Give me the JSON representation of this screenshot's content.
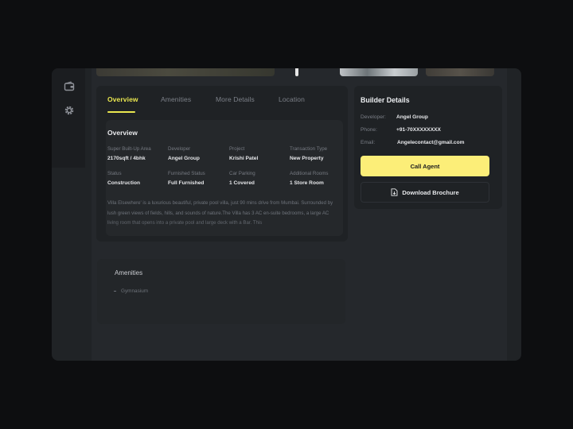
{
  "sidebar": {
    "icons": [
      "wallet-icon",
      "gear-icon"
    ]
  },
  "tabs": [
    {
      "label": "Overview",
      "active": true
    },
    {
      "label": "Amenities",
      "active": false
    },
    {
      "label": "More Details",
      "active": false
    },
    {
      "label": "Location",
      "active": false
    }
  ],
  "overview": {
    "title": "Overview",
    "fields": [
      {
        "label": "Super Built-Up Area",
        "value": "2170sqft / 4bhk"
      },
      {
        "label": "Developer",
        "value": "Angel Group"
      },
      {
        "label": "Project",
        "value": "Krishi Patel"
      },
      {
        "label": "Transaction Type",
        "value": "New Property"
      },
      {
        "label": "Status",
        "value": "Construction"
      },
      {
        "label": "Furnished Status",
        "value": "Full Furnished"
      },
      {
        "label": "Car Parking",
        "value": "1 Covered"
      },
      {
        "label": "Additional Rooms",
        "value": "1 Store Room"
      }
    ],
    "description": "Villa Elsewhere' is a luxurious beautiful, private pool villa, just 90 mins drive from Mumbai. Surrounded by lush green views of fields, hills, and sounds of nature.The Villa has 3 AC en-suite bedrooms, a large AC living room that opens into a private pool and large deck with a Bar. This"
  },
  "amenities": {
    "title": "Amenities",
    "items": [
      "Gymnasium"
    ]
  },
  "builder": {
    "title": "Builder Details",
    "developer_label": "Developer:",
    "developer_value": "Angel Group",
    "phone_label": "Phone:",
    "phone_value": "+91-70XXXXXXXX",
    "email_label": "Email:",
    "email_value": "Angelecontact@gmail.com",
    "call_label": "Call Agent",
    "brochure_label": "Download Brochure"
  },
  "colors": {
    "accent": "#e9e64f",
    "call_button": "#fcee78",
    "background": "#0d0e10",
    "panel": "#202326"
  }
}
